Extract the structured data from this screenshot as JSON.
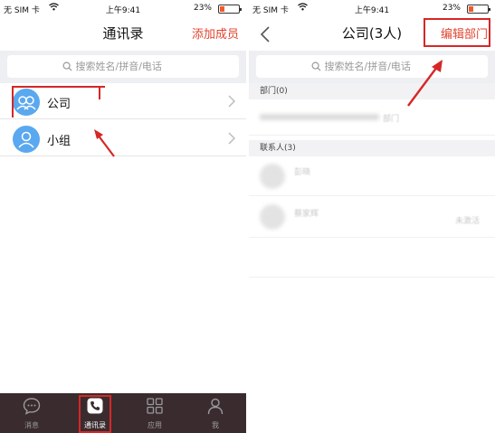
{
  "left": {
    "status": {
      "carrier": "无 SIM 卡",
      "time": "上午9:41",
      "battery_pct": "23%",
      "battery_level": 0.23
    },
    "nav": {
      "title": "通讯录",
      "right_action": "添加成员"
    },
    "search": {
      "placeholder": "搜索姓名/拼音/电话"
    },
    "items": [
      {
        "label": "公司",
        "icon": "company-group-icon"
      },
      {
        "label": "小组",
        "icon": "group-people-icon"
      }
    ],
    "tabs": [
      {
        "label": "消息",
        "icon": "chat-bubble-icon",
        "active": false
      },
      {
        "label": "通讯录",
        "icon": "phone-icon",
        "active": true
      },
      {
        "label": "应用",
        "icon": "grid-icon",
        "active": false
      },
      {
        "label": "我",
        "icon": "person-icon",
        "active": false
      }
    ]
  },
  "right": {
    "status": {
      "carrier": "无 SIM 卡",
      "time": "上午9:41",
      "battery_pct": "23%",
      "battery_level": 0.23
    },
    "nav": {
      "title": "公司(3人)",
      "right_action": "编辑部门",
      "back_icon": "back-chevron-icon"
    },
    "search": {
      "placeholder": "搜索姓名/拼音/电话"
    },
    "departments_header": "部门(0)",
    "department_row_suffix": "部门",
    "contacts_header": "联系人(3)",
    "contacts": [
      {
        "name": "彭晓",
        "status": ""
      },
      {
        "name": "蔡家辉",
        "status": "未激活"
      },
      {
        "name": "",
        "status": ""
      }
    ]
  },
  "colors": {
    "accent": "#e2442f",
    "tabbar": "#3a2b2f",
    "avatar": "#5aa8f0",
    "annotation": "#d62727"
  }
}
